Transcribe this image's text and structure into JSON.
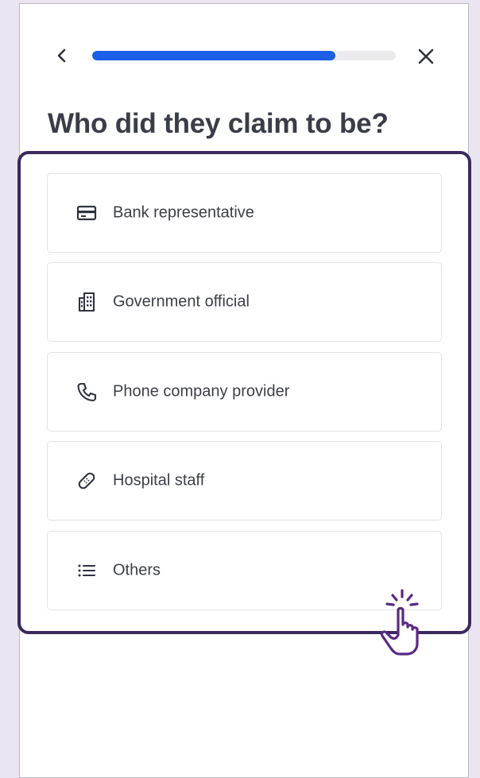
{
  "header": {
    "progress": 0.8,
    "back_icon": "chevron-left-icon",
    "close_icon": "close-icon"
  },
  "question": {
    "title": "Who did they claim to be?"
  },
  "options": [
    {
      "label": "Bank representative",
      "icon": "credit-card-icon"
    },
    {
      "label": "Government official",
      "icon": "building-icon"
    },
    {
      "label": "Phone company provider",
      "icon": "phone-icon"
    },
    {
      "label": "Hospital staff",
      "icon": "bandage-icon"
    },
    {
      "label": "Others",
      "icon": "list-icon"
    }
  ],
  "colors": {
    "accent": "#1a5fe5",
    "highlight": "#3b2a5e",
    "cursor": "#5a2a82",
    "background": "#ebe5f1"
  }
}
